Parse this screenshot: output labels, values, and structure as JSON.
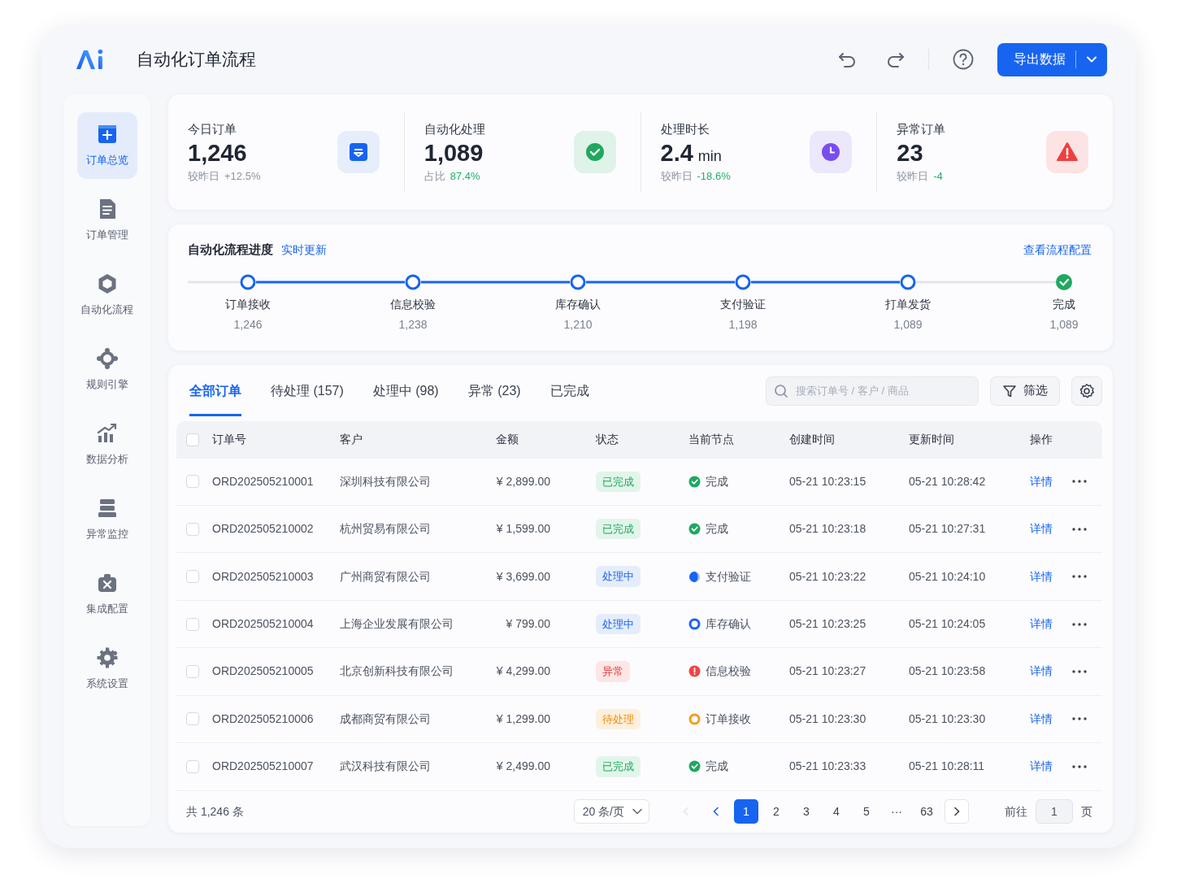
{
  "header": {
    "title": "自动化订单流程",
    "export_button": "导出数据"
  },
  "sidebar": {
    "items": [
      {
        "label": "订单总览",
        "selected": true
      },
      {
        "label": "订单管理",
        "selected": false
      },
      {
        "label": "自动化流程",
        "selected": false
      },
      {
        "label": "规则引擎",
        "selected": false
      },
      {
        "label": "数据分析",
        "selected": false
      },
      {
        "label": "异常监控",
        "selected": false
      },
      {
        "label": "集成配置",
        "selected": false
      },
      {
        "label": "系统设置",
        "selected": false
      }
    ]
  },
  "stats": [
    {
      "label": "今日订单",
      "value": "1,246",
      "sub_label": "较昨日",
      "change": {
        "text": "+12.5%",
        "kind": "neutral"
      }
    },
    {
      "label": "自动化处理",
      "value": "1,089",
      "sub_label": "占比",
      "change": {
        "text": "87.4%",
        "kind": "good"
      }
    },
    {
      "label": "处理时长",
      "value": "2.4",
      "unit": "min",
      "sub_label": "较昨日",
      "change": {
        "text": "-18.6%",
        "kind": "good"
      }
    },
    {
      "label": "异常订单",
      "value": "23",
      "sub_label": "较昨日",
      "change": {
        "text": "-4",
        "kind": "good"
      }
    }
  ],
  "flow": {
    "title": "自动化流程进度",
    "live_label": "实时更新",
    "config_link": "查看流程配置",
    "steps": [
      {
        "label": "订单接收",
        "count": "1,246",
        "kind": "ring"
      },
      {
        "label": "信息校验",
        "count": "1,238",
        "kind": "ring"
      },
      {
        "label": "库存确认",
        "count": "1,210",
        "kind": "ring"
      },
      {
        "label": "支付验证",
        "count": "1,198",
        "kind": "ring"
      },
      {
        "label": "打单发货",
        "count": "1,089",
        "kind": "ring"
      },
      {
        "label": "完成",
        "count": "1,089",
        "kind": "check"
      }
    ]
  },
  "tabs": [
    {
      "label": "全部订单",
      "selected": true
    },
    {
      "label": "待处理 (157)",
      "selected": false
    },
    {
      "label": "处理中 (98)",
      "selected": false
    },
    {
      "label": "异常 (23)",
      "selected": false
    },
    {
      "label": "已完成",
      "selected": false
    }
  ],
  "search": {
    "placeholder": "搜索订单号 / 客户 / 商品"
  },
  "filter_button": "筛选",
  "table": {
    "select_all_checked": false,
    "columns": [
      "订单号",
      "客户",
      "金额",
      "状态",
      "当前节点",
      "创建时间",
      "更新时间",
      "操作"
    ],
    "rows": [
      {
        "checked": false,
        "order_no": "ORD202505210001",
        "customer": "深圳科技有限公司",
        "amount": "¥ 2,899.00",
        "status": {
          "label": "已完成",
          "kind": "done"
        },
        "node": {
          "label": "完成",
          "kind": "check"
        },
        "created": "05-21 10:23:15",
        "updated": "05-21 10:28:42",
        "action": "详情"
      },
      {
        "checked": false,
        "order_no": "ORD202505210002",
        "customer": "杭州贸易有限公司",
        "amount": "¥ 1,599.00",
        "status": {
          "label": "已完成",
          "kind": "done"
        },
        "node": {
          "label": "完成",
          "kind": "check"
        },
        "created": "05-21 10:23:18",
        "updated": "05-21 10:27:31",
        "action": "详情"
      },
      {
        "checked": false,
        "order_no": "ORD202505210003",
        "customer": "广州商贸有限公司",
        "amount": "¥ 3,699.00",
        "status": {
          "label": "处理中",
          "kind": "processing"
        },
        "node": {
          "label": "支付验证",
          "kind": "half"
        },
        "created": "05-21 10:23:22",
        "updated": "05-21 10:24:10",
        "action": "详情"
      },
      {
        "checked": false,
        "order_no": "ORD202505210004",
        "customer": "上海企业发展有限公司",
        "amount": "¥ 799.00",
        "status": {
          "label": "处理中",
          "kind": "processing"
        },
        "node": {
          "label": "库存确认",
          "kind": "ring"
        },
        "created": "05-21 10:23:25",
        "updated": "05-21 10:24:05",
        "action": "详情"
      },
      {
        "checked": false,
        "order_no": "ORD202505210005",
        "customer": "北京创新科技有限公司",
        "amount": "¥ 4,299.00",
        "status": {
          "label": "异常",
          "kind": "error"
        },
        "node": {
          "label": "信息校验",
          "kind": "error"
        },
        "created": "05-21 10:23:27",
        "updated": "05-21 10:23:58",
        "action": "详情"
      },
      {
        "checked": false,
        "order_no": "ORD202505210006",
        "customer": "成都商贸有限公司",
        "amount": "¥ 1,299.00",
        "status": {
          "label": "待处理",
          "kind": "pending"
        },
        "node": {
          "label": "订单接收",
          "kind": "pending"
        },
        "created": "05-21 10:23:30",
        "updated": "05-21 10:23:30",
        "action": "详情"
      },
      {
        "checked": false,
        "order_no": "ORD202505210007",
        "customer": "武汉科技有限公司",
        "amount": "¥ 2,499.00",
        "status": {
          "label": "已完成",
          "kind": "done"
        },
        "node": {
          "label": "完成",
          "kind": "check"
        },
        "created": "05-21 10:23:33",
        "updated": "05-21 10:28:11",
        "action": "详情"
      }
    ]
  },
  "footer": {
    "total": "共 1,246 条",
    "page_size": "20 条/页",
    "prev_buttons": [
      {
        "disabled": true
      },
      {
        "disabled": false
      }
    ],
    "pages": [
      {
        "label": "1",
        "selected": true,
        "kind": "page"
      },
      {
        "label": "2",
        "selected": false,
        "kind": "page"
      },
      {
        "label": "3",
        "selected": false,
        "kind": "page"
      },
      {
        "label": "4",
        "selected": false,
        "kind": "page"
      },
      {
        "label": "5",
        "selected": false,
        "kind": "page"
      },
      {
        "label": "···",
        "kind": "ellipsis"
      },
      {
        "label": "63",
        "selected": false,
        "kind": "page"
      }
    ],
    "goto_label": "前往",
    "goto_value": "1",
    "page_unit": "页"
  }
}
